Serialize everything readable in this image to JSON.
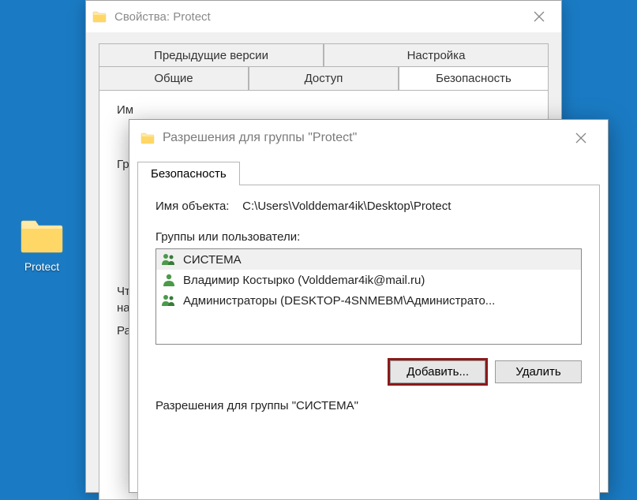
{
  "desktop": {
    "icon_label": "Protect"
  },
  "properties_dialog": {
    "title": "Свойства: Protect",
    "tabs_row1": {
      "prev_versions": "Предыдущие версии",
      "settings": "Настройка"
    },
    "tabs_row2": {
      "general": "Общие",
      "access": "Доступ",
      "security": "Безопасность"
    },
    "object_name_label_partial": "Им",
    "groups_label_partial": "Гр",
    "change_label_partial1": "Чт",
    "change_label_partial2": "на",
    "perms_label_partial": "Ра"
  },
  "permissions_dialog": {
    "title": "Разрешения для группы \"Protect\"",
    "tab_security": "Безопасность",
    "object_name_label": "Имя объекта:",
    "object_path": "C:\\Users\\Volddemar4ik\\Desktop\\Protect",
    "groups_label": "Группы или пользователи:",
    "users": [
      {
        "name": "СИСТЕМА",
        "type": "group",
        "selected": true
      },
      {
        "name": "Владимир Костырко (Volddemar4ik@mail.ru)",
        "type": "user",
        "selected": false
      },
      {
        "name": "Администраторы (DESKTOP-4SNMEBM\\Администрато...",
        "type": "group",
        "selected": false
      }
    ],
    "add_button": "Добавить...",
    "remove_button": "Удалить",
    "permissions_for_label": "Разрешения для группы \"СИСТЕМА\""
  }
}
